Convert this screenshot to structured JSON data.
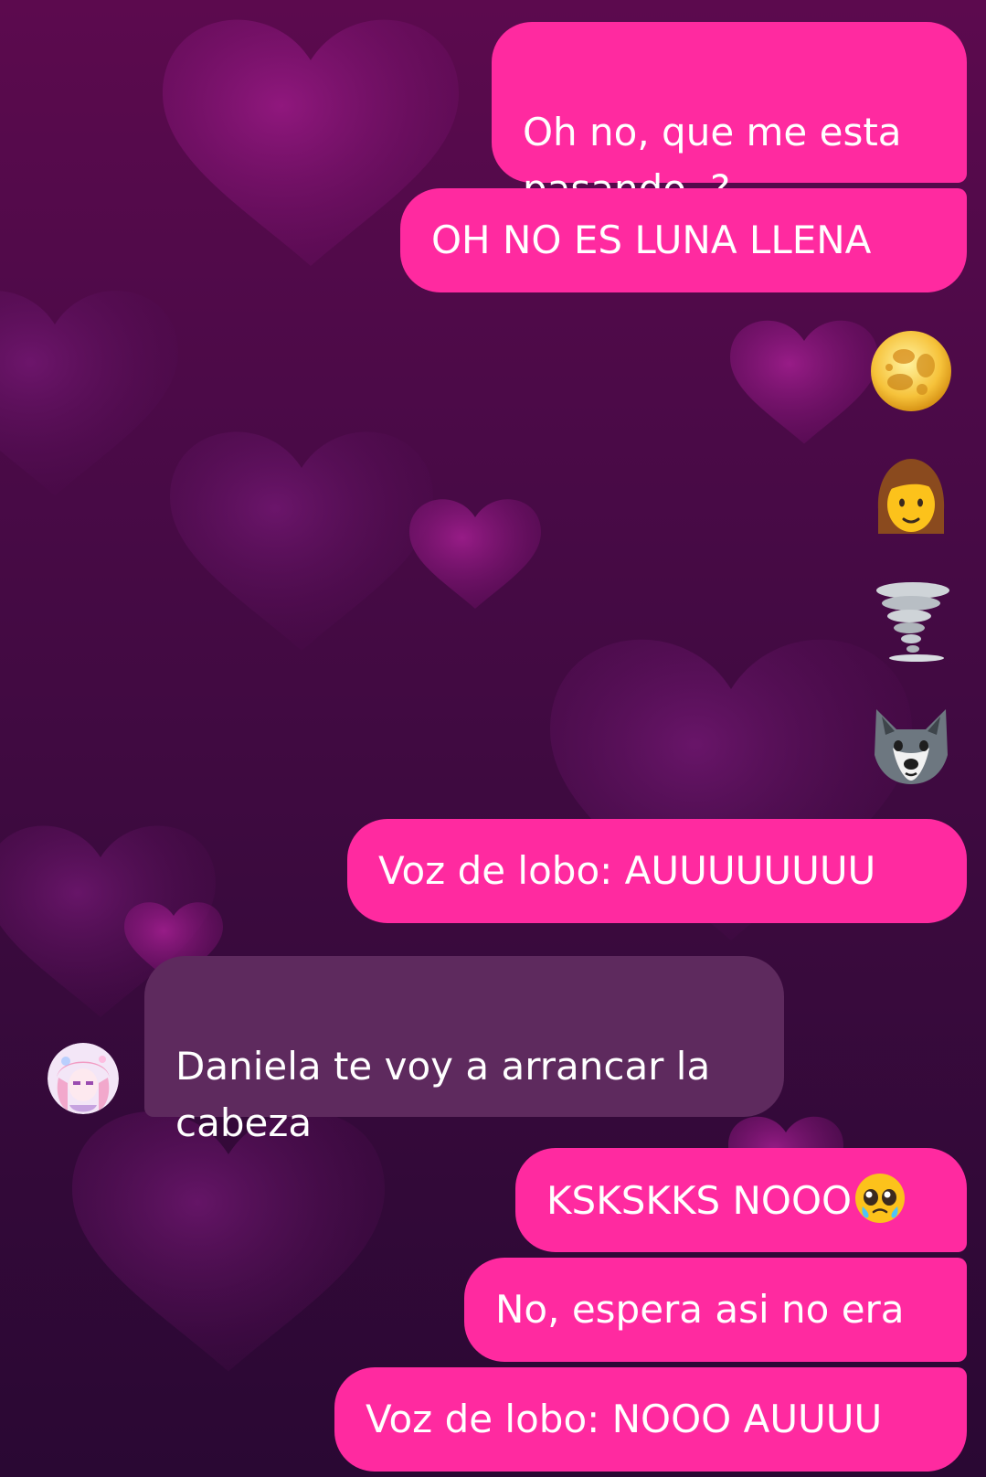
{
  "messages": [
    {
      "text": "Oh no, que me esta\npasando..?"
    },
    {
      "text": "OH NO ES LUNA LLENA"
    },
    {
      "text": "Voz de lobo: AUUUUUUUU"
    },
    {
      "text": "Daniela te voy a arrancar la\ncabeza"
    },
    {
      "text": "KSKSKKS NOOO"
    },
    {
      "text": "No, espera asi no era"
    },
    {
      "text": "Voz de lobo: NOOO AUUUU"
    }
  ],
  "emoji_messages": [
    {
      "icon": "full-moon-icon"
    },
    {
      "icon": "woman-icon"
    },
    {
      "icon": "tornado-icon"
    },
    {
      "icon": "wolf-icon"
    }
  ],
  "inline_emoji": "pleading-face-with-tear-icon",
  "colors": {
    "outgoing_bubble": "#ff2aa0",
    "incoming_bubble": "#5e2a5e",
    "background": "#4a0a47"
  }
}
